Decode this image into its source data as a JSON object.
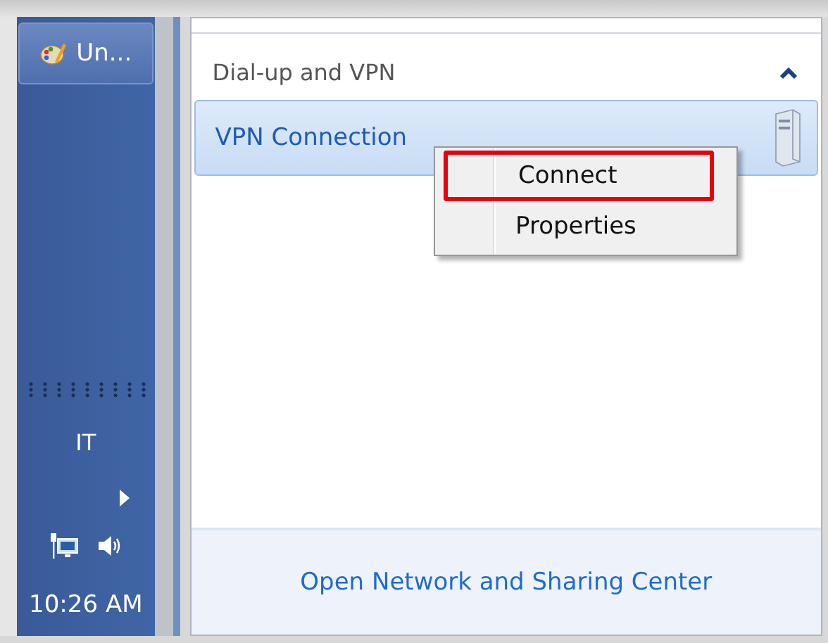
{
  "taskbar": {
    "app_button": {
      "label": "Un..."
    },
    "language": "IT",
    "clock": "10:26 AM"
  },
  "panel": {
    "section": {
      "title": "Dial-up and VPN",
      "expanded": true
    },
    "connections": [
      {
        "name": "VPN Connection",
        "selected": true
      }
    ],
    "footer_link": "Open Network and Sharing Center"
  },
  "context_menu": {
    "items": [
      {
        "label": "Connect",
        "highlighted": true
      },
      {
        "label": "Properties",
        "highlighted": false
      }
    ]
  }
}
